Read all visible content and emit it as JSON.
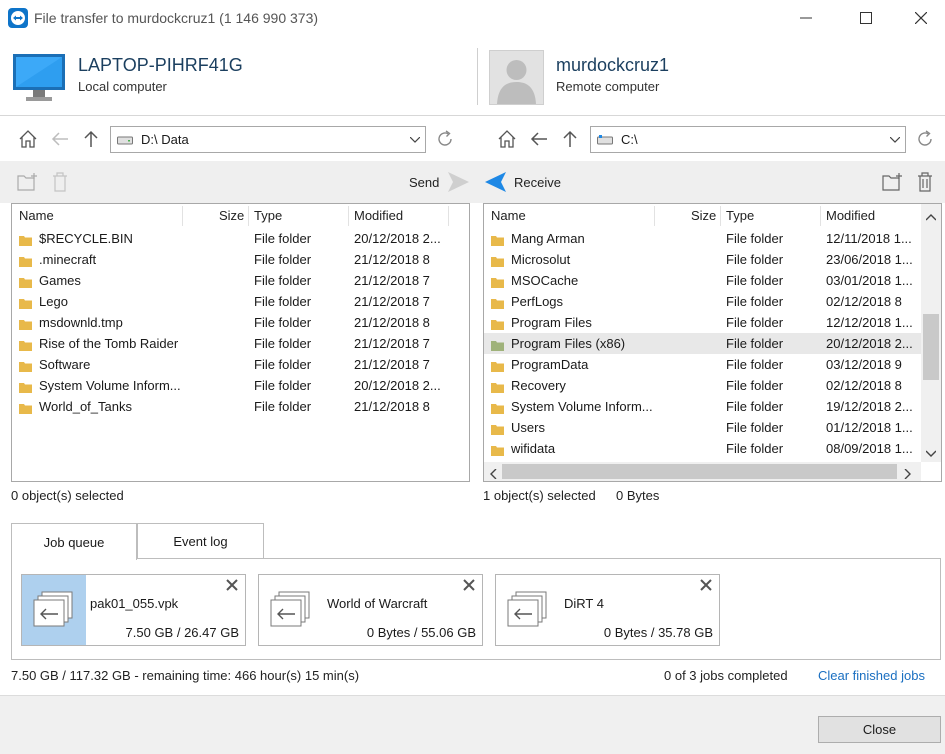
{
  "window": {
    "title": "File transfer to murdockcruz1 (1 146 990 373)",
    "accent": "#0e74c9"
  },
  "local": {
    "name": "LAPTOP-PIHRF41G",
    "subtitle": "Local computer",
    "path": "D:\\  Data",
    "action_label": "Send",
    "columns": [
      "Name",
      "Size",
      "Type",
      "Modified"
    ],
    "files": [
      {
        "name": "$RECYCLE.BIN",
        "size": "",
        "type": "File folder",
        "modified": "20/12/2018 2..."
      },
      {
        "name": ".minecraft",
        "size": "",
        "type": "File folder",
        "modified": "21/12/2018 8"
      },
      {
        "name": "Games",
        "size": "",
        "type": "File folder",
        "modified": "21/12/2018 7"
      },
      {
        "name": "Lego",
        "size": "",
        "type": "File folder",
        "modified": "21/12/2018 7"
      },
      {
        "name": "msdownld.tmp",
        "size": "",
        "type": "File folder",
        "modified": "21/12/2018 8"
      },
      {
        "name": "Rise of the Tomb Raider",
        "size": "",
        "type": "File folder",
        "modified": "21/12/2018 7"
      },
      {
        "name": "Software",
        "size": "",
        "type": "File folder",
        "modified": "21/12/2018 7"
      },
      {
        "name": "System Volume Inform...",
        "size": "",
        "type": "File folder",
        "modified": "20/12/2018 2..."
      },
      {
        "name": "World_of_Tanks",
        "size": "",
        "type": "File folder",
        "modified": "21/12/2018 8"
      }
    ],
    "status": "0 object(s) selected"
  },
  "remote": {
    "name": "murdockcruz1",
    "subtitle": "Remote computer",
    "path": "C:\\",
    "action_label": "Receive",
    "columns": [
      "Name",
      "Size",
      "Type",
      "Modified"
    ],
    "files": [
      {
        "name": "Mang Arman",
        "size": "",
        "type": "File folder",
        "modified": "12/11/2018 1..."
      },
      {
        "name": "Microsolut",
        "size": "",
        "type": "File folder",
        "modified": "23/06/2018 1..."
      },
      {
        "name": "MSOCache",
        "size": "",
        "type": "File folder",
        "modified": "03/01/2018 1..."
      },
      {
        "name": "PerfLogs",
        "size": "",
        "type": "File folder",
        "modified": "02/12/2018 8"
      },
      {
        "name": "Program Files",
        "size": "",
        "type": "File folder",
        "modified": "12/12/2018 1..."
      },
      {
        "name": "Program Files (x86)",
        "size": "",
        "type": "File folder",
        "modified": "20/12/2018 2...",
        "selected": true
      },
      {
        "name": "ProgramData",
        "size": "",
        "type": "File folder",
        "modified": "03/12/2018 9"
      },
      {
        "name": "Recovery",
        "size": "",
        "type": "File folder",
        "modified": "02/12/2018 8"
      },
      {
        "name": "System Volume Inform...",
        "size": "",
        "type": "File folder",
        "modified": "19/12/2018 2..."
      },
      {
        "name": "Users",
        "size": "",
        "type": "File folder",
        "modified": "01/12/2018 1..."
      },
      {
        "name": "wifidata",
        "size": "",
        "type": "File folder",
        "modified": "08/09/2018 1..."
      }
    ],
    "status": "1 object(s) selected",
    "status_bytes": "0 Bytes"
  },
  "tabs": {
    "job_queue": "Job queue",
    "event_log": "Event log"
  },
  "jobs": [
    {
      "name": "pak01_055.vpk",
      "progress": "7.50 GB / 26.47 GB",
      "active": true
    },
    {
      "name": "World of Warcraft",
      "progress": "0 Bytes / 55.06 GB",
      "active": false
    },
    {
      "name": "DiRT 4",
      "progress": "0 Bytes / 35.78 GB",
      "active": false
    }
  ],
  "summary": {
    "transfer": "7.50 GB / 117.32 GB - remaining time: 466 hour(s) 15 min(s)",
    "jobs_done": "0 of 3 jobs completed",
    "clear_link": "Clear finished jobs"
  },
  "close_label": "Close"
}
